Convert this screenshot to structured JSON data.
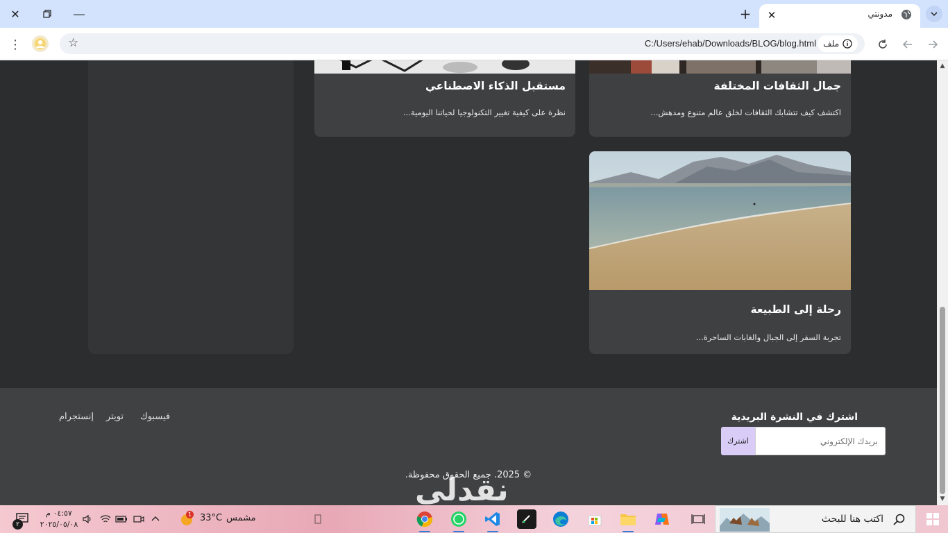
{
  "browser": {
    "tab_title": "مدونتي",
    "url": "C:/Users/ehab/Downloads/BLOG/blog.html",
    "file_chip_label": "ملف"
  },
  "cards": [
    {
      "title": "جمال الثقافات المختلفة",
      "description": "اكتشف كيف تتشابك الثقافات لخلق عالم متنوع ومدهش..."
    },
    {
      "title": "مستقبل الذكاء الاصطناعي",
      "description": "نظرة على كيفية تغيير التكنولوجيا لحياتنا اليومية..."
    },
    {
      "title": "رحلة إلى الطبيعة",
      "description": "تجربة السفر إلى الجبال والغابات الساحرة..."
    }
  ],
  "footer": {
    "newsletter_title": "اشترك في النشرة البريدية",
    "email_placeholder": "بريدك الإلكتروني",
    "subscribe_label": "اشترك",
    "social": {
      "facebook": "فيسبوك",
      "twitter": "تويتر",
      "instagram": "إنستجرام"
    },
    "copyright": "© 2025. جميع الحقوق محفوظة."
  },
  "watermark": "نقدلي",
  "taskbar": {
    "search_placeholder": "اكتب هنا للبحث",
    "weather_temp": "33°C",
    "weather_desc": "مشمس",
    "weather_badge": "1",
    "time": "٠٤:٥٧ م",
    "date": "٢٠٢٥/٠٥/٠٨",
    "notification_count": "٢"
  }
}
